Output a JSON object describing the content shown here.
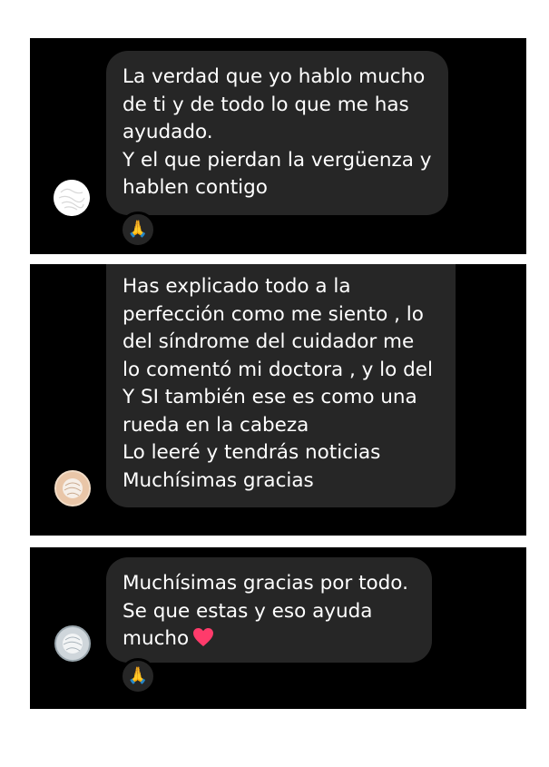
{
  "messages": [
    {
      "lines": [
        "La verdad que yo hablo mucho",
        "de ti y de todo lo que me has",
        "ayudado.",
        "Y el que pierdan la vergüenza y",
        "hablen contigo"
      ],
      "reaction": "🙏"
    },
    {
      "lines": [
        "Has explicado todo a la",
        "perfección como me siento , lo",
        "del síndrome del cuidador me",
        "lo comentó mi doctora , y lo del",
        "Y SI también ese es como una",
        "rueda en la cabeza",
        "Lo leeré y tendrás noticias",
        "Muchísimas gracias"
      ]
    },
    {
      "lines": [
        "Muchísimas gracias por todo.",
        "Se que estas y eso ayuda",
        "mucho"
      ],
      "reaction": "🙏"
    }
  ],
  "colors": {
    "panel_bg": "#000000",
    "bubble_bg": "#262626",
    "text": "#ffffff",
    "heart": "#ff3b6b"
  },
  "icons": {
    "reaction_icon": "folded-hands-emoji",
    "heart_icon": "red-heart-emoji"
  }
}
